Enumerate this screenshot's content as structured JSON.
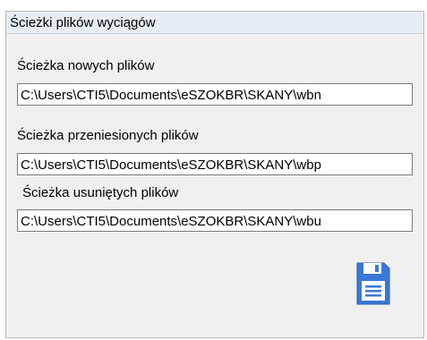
{
  "panel": {
    "title": "Ścieżki plików wyciągów"
  },
  "fields": [
    {
      "label": "Ścieżka nowych plików",
      "value": "C:\\Users\\CTI5\\Documents\\eSZOKBR\\SKANY\\wbn"
    },
    {
      "label": "Ścieżka przeniesionych plików",
      "value": "C:\\Users\\CTI5\\Documents\\eSZOKBR\\SKANY\\wbp"
    },
    {
      "label": "Ścieżka usuniętych plików",
      "value": "C:\\Users\\CTI5\\Documents\\eSZOKBR\\SKANY\\wbu"
    }
  ],
  "save_button": {
    "icon": "save-icon",
    "color": "#3a78d6"
  }
}
